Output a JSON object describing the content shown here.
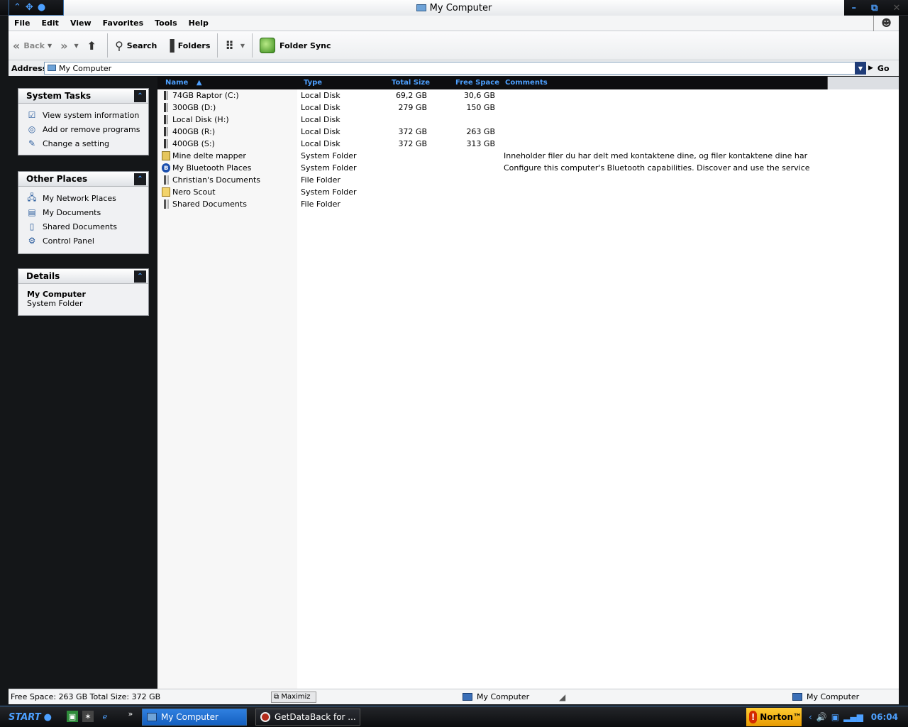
{
  "window": {
    "title": "My Computer",
    "sys_icons": [
      "chevron-up-icon",
      "settings-icon",
      "alien-icon"
    ],
    "win_buttons": [
      "minimize-icon",
      "restore-icon",
      "close-icon"
    ]
  },
  "menu": [
    "File",
    "Edit",
    "View",
    "Favorites",
    "Tools",
    "Help"
  ],
  "toolbar": {
    "back": "Back",
    "search": "Search",
    "folders": "Folders",
    "folder_sync": "Folder Sync"
  },
  "address": {
    "label": "Address",
    "value": "My Computer",
    "go": "Go"
  },
  "left_panels": {
    "system_tasks": {
      "title": "System Tasks",
      "items": [
        "View system information",
        "Add or remove programs",
        "Change a setting"
      ]
    },
    "other_places": {
      "title": "Other Places",
      "items": [
        "My Network Places",
        "My Documents",
        "Shared Documents",
        "Control Panel"
      ]
    },
    "details": {
      "title": "Details",
      "name": "My Computer",
      "type": "System Folder"
    }
  },
  "columns": [
    "Name",
    "Type",
    "Total Size",
    "Free Space",
    "Comments"
  ],
  "rows": [
    {
      "name": "74GB Raptor (C:)",
      "type": "Local Disk",
      "total": "69,2 GB",
      "free": "30,6 GB",
      "comment": "",
      "icon": "disk"
    },
    {
      "name": "300GB (D:)",
      "type": "Local Disk",
      "total": "279 GB",
      "free": "150 GB",
      "comment": "",
      "icon": "disk"
    },
    {
      "name": "Local Disk (H:)",
      "type": "Local Disk",
      "total": "",
      "free": "",
      "comment": "",
      "icon": "disk"
    },
    {
      "name": "400GB (R:)",
      "type": "Local Disk",
      "total": "372 GB",
      "free": "263 GB",
      "comment": "",
      "icon": "disk"
    },
    {
      "name": "400GB (S:)",
      "type": "Local Disk",
      "total": "372 GB",
      "free": "313 GB",
      "comment": "",
      "icon": "disk"
    },
    {
      "name": "Mine delte mapper",
      "type": "System Folder",
      "total": "",
      "free": "",
      "comment": "Inneholder filer du har delt med kontaktene dine, og filer kontaktene dine har",
      "icon": "share"
    },
    {
      "name": "My Bluetooth Places",
      "type": "System Folder",
      "total": "",
      "free": "",
      "comment": "Configure this computer's Bluetooth capabilities.  Discover and use the service",
      "icon": "bt"
    },
    {
      "name": "Christian's Documents",
      "type": "File Folder",
      "total": "",
      "free": "",
      "comment": "",
      "icon": "folder"
    },
    {
      "name": "Nero Scout",
      "type": "System Folder",
      "total": "",
      "free": "",
      "comment": "",
      "icon": "scout"
    },
    {
      "name": "Shared Documents",
      "type": "File Folder",
      "total": "",
      "free": "",
      "comment": "",
      "icon": "folder"
    }
  ],
  "status": {
    "text": "Free Space: 263 GB Total Size: 372 GB",
    "maximize": "Maximiz",
    "location": "My Computer",
    "location2": "My Computer"
  },
  "taskbar": {
    "start": "START",
    "tasks": [
      "My Computer",
      "GetDataBack for ..."
    ],
    "norton": "Norton™",
    "clock": "06:04"
  }
}
